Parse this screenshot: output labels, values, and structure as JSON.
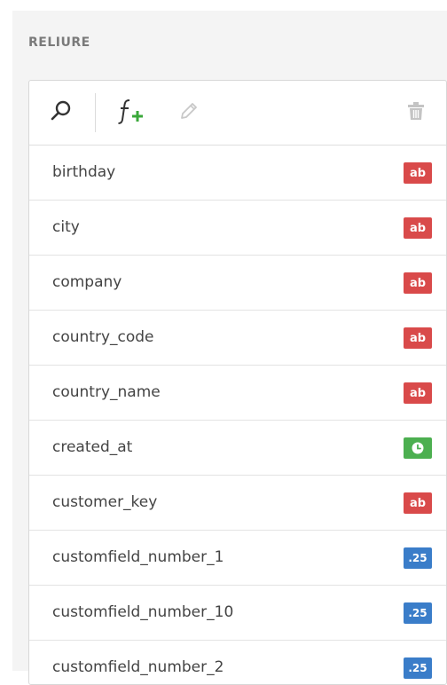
{
  "section": {
    "title": "RELIURE"
  },
  "toolbar": {
    "search_icon": "search-icon",
    "add_field_icon": "function-add-icon",
    "edit_icon": "pencil-icon",
    "delete_icon": "trash-icon"
  },
  "colors": {
    "text_badge": "#d94a4a",
    "date_badge": "#4caf50",
    "number_badge": "#3a7dc9"
  },
  "fields": [
    {
      "name": "birthday",
      "type": "text",
      "badge": "ab"
    },
    {
      "name": "city",
      "type": "text",
      "badge": "ab"
    },
    {
      "name": "company",
      "type": "text",
      "badge": "ab"
    },
    {
      "name": "country_code",
      "type": "text",
      "badge": "ab"
    },
    {
      "name": "country_name",
      "type": "text",
      "badge": "ab"
    },
    {
      "name": "created_at",
      "type": "date",
      "badge": ""
    },
    {
      "name": "customer_key",
      "type": "text",
      "badge": "ab"
    },
    {
      "name": "customfield_number_1",
      "type": "number",
      "badge": ".25"
    },
    {
      "name": "customfield_number_10",
      "type": "number",
      "badge": ".25"
    },
    {
      "name": "customfield_number_2",
      "type": "number",
      "badge": ".25"
    }
  ]
}
